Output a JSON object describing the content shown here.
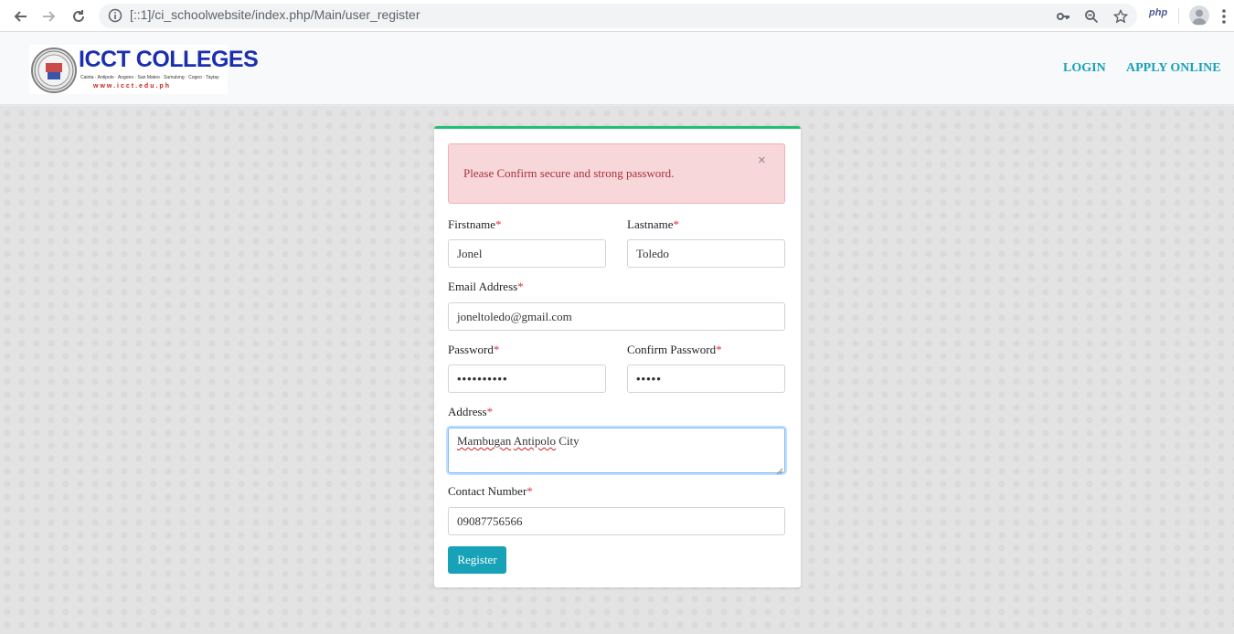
{
  "browser": {
    "url": "[::1]/ci_schoolwebsite/index.php/Main/user_register",
    "extension_label": "php",
    "icons": [
      "back-arrow-icon",
      "forward-arrow-icon",
      "reload-icon",
      "info-icon",
      "key-icon",
      "zoom-icon",
      "star-icon",
      "profile-icon",
      "menu-dots-icon"
    ]
  },
  "header": {
    "logo": {
      "title": "ICCT COLLEGES",
      "campuses": "Cainta · Antipolo · Angono · San Mateo · Sumulong · Cogeo · Taytay",
      "website": "www.icct.edu.ph"
    },
    "nav": {
      "login": "LOGIN",
      "apply_online": "APPLY ONLINE"
    }
  },
  "alert": {
    "message": "Please Confirm secure and strong password.",
    "close": "×"
  },
  "form": {
    "required_mark": "*",
    "firstname": {
      "label": "Firstname",
      "value": "Jonel"
    },
    "lastname": {
      "label": "Lastname",
      "value": "Toledo"
    },
    "email": {
      "label": "Email Address",
      "value": "joneltoledo@gmail.com"
    },
    "password": {
      "label": "Password",
      "value": "••••••••••"
    },
    "confirm_password": {
      "label": "Confirm Password",
      "value": "•••••"
    },
    "address": {
      "label": "Address",
      "value_word1": "Mambugan",
      "value_word2": "Antipolo",
      "value_word3": "City"
    },
    "contact": {
      "label": "Contact Number",
      "value": "09087756566"
    },
    "register_label": "Register"
  },
  "colors": {
    "accent": "#17a2b8",
    "card_top_border": "#20c074",
    "alert_bg": "#f8d7da",
    "alert_text": "#a8323d",
    "required": "#dc3545"
  }
}
